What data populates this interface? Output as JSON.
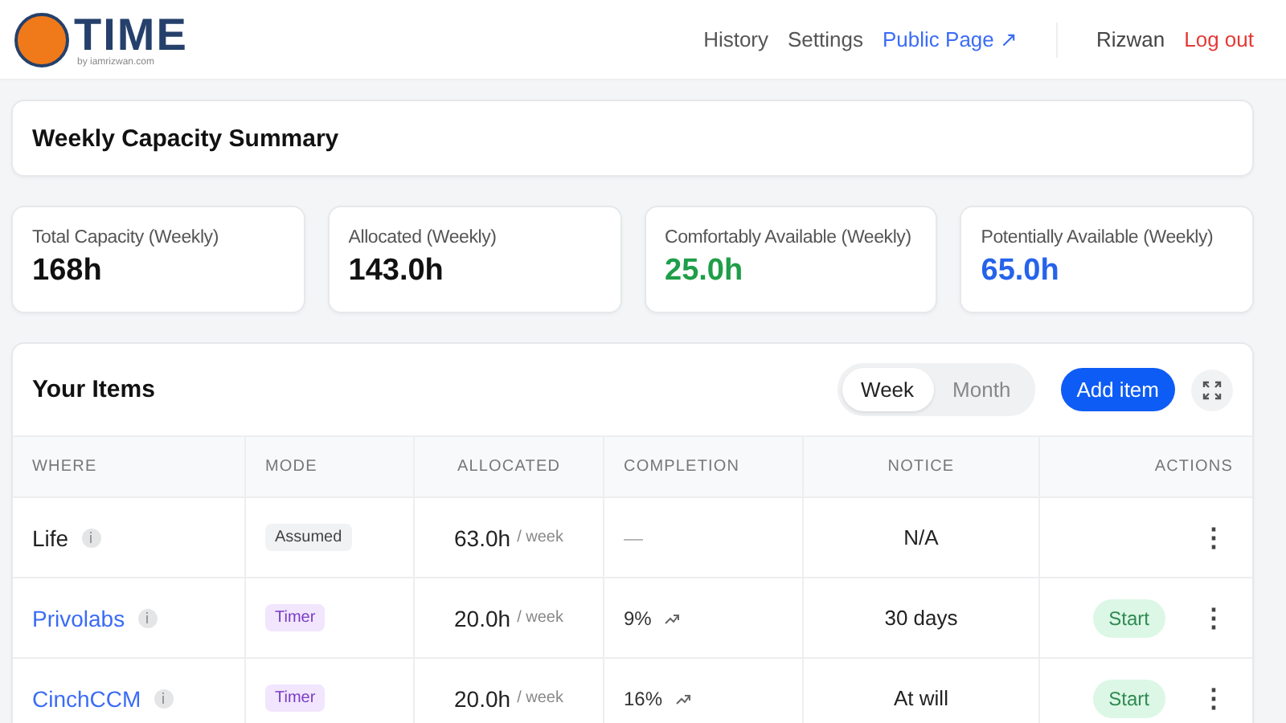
{
  "logo": {
    "title": "TIME",
    "byline": "by iamrizwan.com"
  },
  "nav": [
    {
      "label": "History",
      "kind": "plain"
    },
    {
      "label": "Settings",
      "kind": "plain"
    },
    {
      "label": "Public Page ↗",
      "kind": "external"
    }
  ],
  "user": {
    "name": "Rizwan",
    "logout": "Log out"
  },
  "summary": {
    "title": "Weekly Capacity Summary"
  },
  "stats": [
    {
      "label": "Total Capacity (Weekly)",
      "value": "168h",
      "color": "#111111"
    },
    {
      "label": "Allocated (Weekly)",
      "value": "143.0h",
      "color": "#111111"
    },
    {
      "label": "Comfortably Available (Weekly)",
      "value": "25.0h",
      "color": "#1e9e48"
    },
    {
      "label": "Potentially Available (Weekly)",
      "value": "65.0h",
      "color": "#2563eb"
    }
  ],
  "items": {
    "title": "Your Items",
    "periods": [
      {
        "label": "Week",
        "selected": true
      },
      {
        "label": "Month",
        "selected": false
      }
    ],
    "add_button": "Add item",
    "columns": [
      "WHERE",
      "MODE",
      "ALLOCATED",
      "COMPLETION",
      "NOTICE",
      "ACTIONS"
    ],
    "rows": [
      {
        "name": "Life",
        "link": false,
        "mode": {
          "label": "Assumed",
          "kind": "assumed"
        },
        "allocated": "63.0h",
        "unit": "/ week",
        "completion": "—",
        "trend": false,
        "notice": "N/A",
        "start": null,
        "menu": "⋮"
      },
      {
        "name": "Privolabs",
        "link": true,
        "mode": {
          "label": "Timer",
          "kind": "timer"
        },
        "allocated": "20.0h",
        "unit": "/ week",
        "completion": "9%",
        "trend": true,
        "notice": "30 days",
        "start": "Start",
        "menu": "⋮"
      },
      {
        "name": "CinchCCM",
        "link": true,
        "mode": {
          "label": "Timer",
          "kind": "timer"
        },
        "allocated": "20.0h",
        "unit": "/ week",
        "completion": "16%",
        "trend": true,
        "notice": "At will",
        "start": "Start",
        "menu": "⋮"
      }
    ]
  }
}
